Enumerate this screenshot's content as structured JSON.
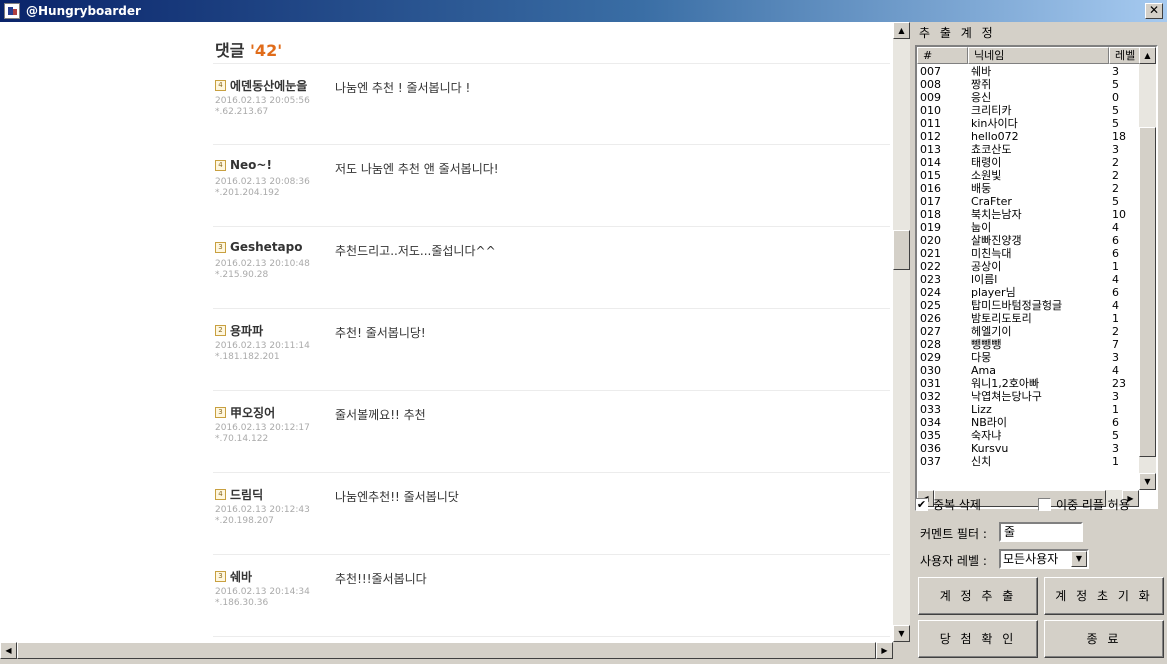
{
  "window": {
    "title": "@Hungryboarder",
    "close_glyph": "✕",
    "icon": "app-icon"
  },
  "browser": {
    "comment_header": {
      "label": "댓글",
      "count": "'42'"
    },
    "comments": [
      {
        "level": "4",
        "nick": "에덴동산에눈을",
        "date": "2016.02.13 20:05:56",
        "ip": "*.62.213.67",
        "text": "나눔엔 추천 ! 줄서봅니다 !"
      },
      {
        "level": "4",
        "nick": "Neo~!",
        "date": "2016.02.13 20:08:36",
        "ip": "*.201.204.192",
        "text": "저도 나눔엔 추천 앤 줄서봅니다!"
      },
      {
        "level": "3",
        "nick": "Geshetapo",
        "date": "2016.02.13 20:10:48",
        "ip": "*.215.90.28",
        "text": "추천드리고..저도...줄섭니다^^"
      },
      {
        "level": "2",
        "nick": "용파파",
        "date": "2016.02.13 20:11:14",
        "ip": "*.181.182.201",
        "text": "추천! 줄서봅니당!"
      },
      {
        "level": "3",
        "nick": "甲오징어",
        "date": "2016.02.13 20:12:17",
        "ip": "*.70.14.122",
        "text": "줄서볼께요!! 추천"
      },
      {
        "level": "4",
        "nick": "드림딕",
        "date": "2016.02.13 20:12:43",
        "ip": "*.20.198.207",
        "text": "나눔엔추천!! 줄서봅니닷"
      },
      {
        "level": "3",
        "nick": "쉐바",
        "date": "2016.02.13 20:14:34",
        "ip": "*.186.30.36",
        "text": "추천!!!줄서봅니다"
      }
    ]
  },
  "panel": {
    "heading": "추 출 계 정",
    "list": {
      "headers": [
        "#",
        "닉네임",
        "레벨"
      ],
      "rows": [
        [
          "007",
          "쉐바",
          "3"
        ],
        [
          "008",
          "짱쥐",
          "5"
        ],
        [
          "009",
          "응신",
          "0"
        ],
        [
          "010",
          "크리티카",
          "5"
        ],
        [
          "011",
          "kin사이다",
          "5"
        ],
        [
          "012",
          "hello072",
          "18"
        ],
        [
          "013",
          "쵸코산도",
          "3"
        ],
        [
          "014",
          "태령이",
          "2"
        ],
        [
          "015",
          "소원빛",
          "2"
        ],
        [
          "016",
          "배둥",
          "2"
        ],
        [
          "017",
          "CraFter",
          "5"
        ],
        [
          "018",
          "북치는남자",
          "10"
        ],
        [
          "019",
          "눕이",
          "4"
        ],
        [
          "020",
          "살빠진양갱",
          "6"
        ],
        [
          "021",
          "미친늑대",
          "6"
        ],
        [
          "022",
          "공상이",
          "1"
        ],
        [
          "023",
          "l이름l",
          "4"
        ],
        [
          "024",
          "player님",
          "6"
        ],
        [
          "025",
          "탑미드바텀정글헝글",
          "4"
        ],
        [
          "026",
          "밤토리도토리",
          "1"
        ],
        [
          "027",
          "헤엘기이",
          "2"
        ],
        [
          "028",
          "뺑뺑뺑",
          "7"
        ],
        [
          "029",
          "다뭉",
          "3"
        ],
        [
          "030",
          "Ama",
          "4"
        ],
        [
          "031",
          "워니1,2호아빠",
          "23"
        ],
        [
          "032",
          "낙엽쳐는당나구",
          "3"
        ],
        [
          "033",
          "Lizz",
          "1"
        ],
        [
          "034",
          "NB라이",
          "6"
        ],
        [
          "035",
          "숙자냐",
          "5"
        ],
        [
          "036",
          "Kursvu",
          "3"
        ],
        [
          "037",
          "신치",
          "1"
        ]
      ]
    },
    "dedupe": {
      "label": "중복 삭제",
      "checked": true
    },
    "allow_double": {
      "label": "이중 리플 허용",
      "checked": false
    },
    "comment_filter": {
      "label": "커멘트 필터 :",
      "value": "줄"
    },
    "user_level": {
      "label": "사용자 레벨 :",
      "value": "모든사용자"
    },
    "buttons": {
      "extract": "계 정 추 출",
      "reset": "계 정 초 기 화",
      "confirm": "당 첨 확 인",
      "exit": "종 료"
    }
  },
  "scroll_glyphs": {
    "up": "▲",
    "down": "▼",
    "left": "◀",
    "right": "▶",
    "check": "✔"
  }
}
